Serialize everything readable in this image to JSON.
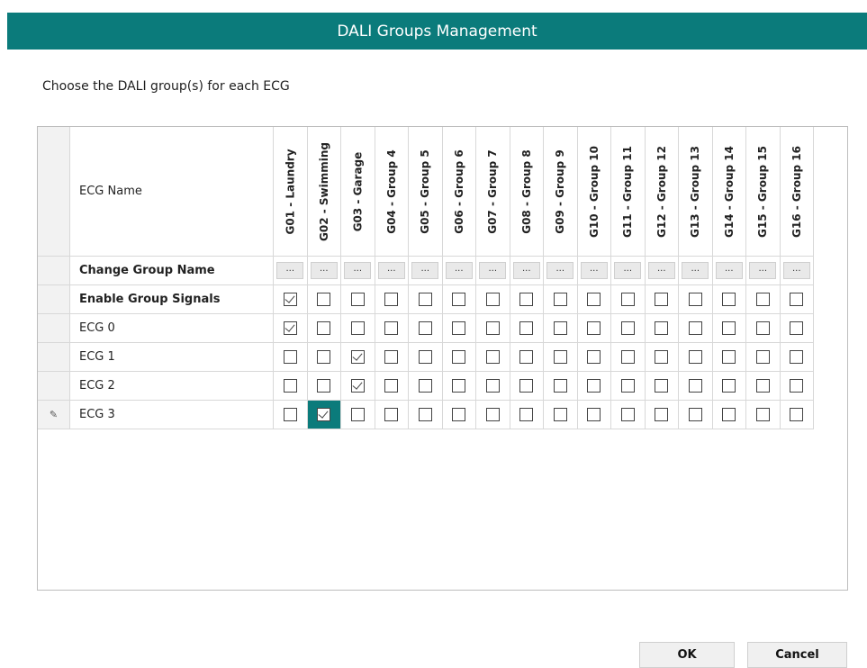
{
  "window": {
    "title": "DALI Groups Management"
  },
  "instructions": "Choose the DALI group(s) for each ECG",
  "grid": {
    "name_header": "ECG Name",
    "groups": [
      "G01 - Laundry",
      "G02 - Swimming",
      "G03 - Garage",
      "G04 - Group 4",
      "G05 - Group 5",
      "G06 - Group 6",
      "G07 - Group 7",
      "G08 - Group 8",
      "G09 - Group 9",
      "G10 - Group 10",
      "G11 - Group 11",
      "G12 - Group 12",
      "G13 - Group 13",
      "G14 - Group 14",
      "G15 - Group 15",
      "G16 - Group 16"
    ],
    "change_name_row": {
      "label": "Change Group Name",
      "button_label": "..."
    },
    "rows": [
      {
        "label": "Enable Group Signals",
        "bold": true,
        "checked": [
          1,
          0,
          0,
          0,
          0,
          0,
          0,
          0,
          0,
          0,
          0,
          0,
          0,
          0,
          0,
          0
        ]
      },
      {
        "label": "ECG 0",
        "bold": false,
        "checked": [
          1,
          0,
          0,
          0,
          0,
          0,
          0,
          0,
          0,
          0,
          0,
          0,
          0,
          0,
          0,
          0
        ]
      },
      {
        "label": "ECG 1",
        "bold": false,
        "checked": [
          0,
          0,
          1,
          0,
          0,
          0,
          0,
          0,
          0,
          0,
          0,
          0,
          0,
          0,
          0,
          0
        ]
      },
      {
        "label": "ECG 2",
        "bold": false,
        "checked": [
          0,
          0,
          1,
          0,
          0,
          0,
          0,
          0,
          0,
          0,
          0,
          0,
          0,
          0,
          0,
          0
        ]
      },
      {
        "label": "ECG 3",
        "bold": false,
        "checked": [
          0,
          1,
          0,
          0,
          0,
          0,
          0,
          0,
          0,
          0,
          0,
          0,
          0,
          0,
          0,
          0
        ],
        "editing": true,
        "selected_col": 1
      }
    ],
    "edit_row_icon": "pencil-icon"
  },
  "buttons": {
    "ok": "OK",
    "cancel": "Cancel"
  },
  "colors": {
    "accent": "#0b7b7b"
  }
}
